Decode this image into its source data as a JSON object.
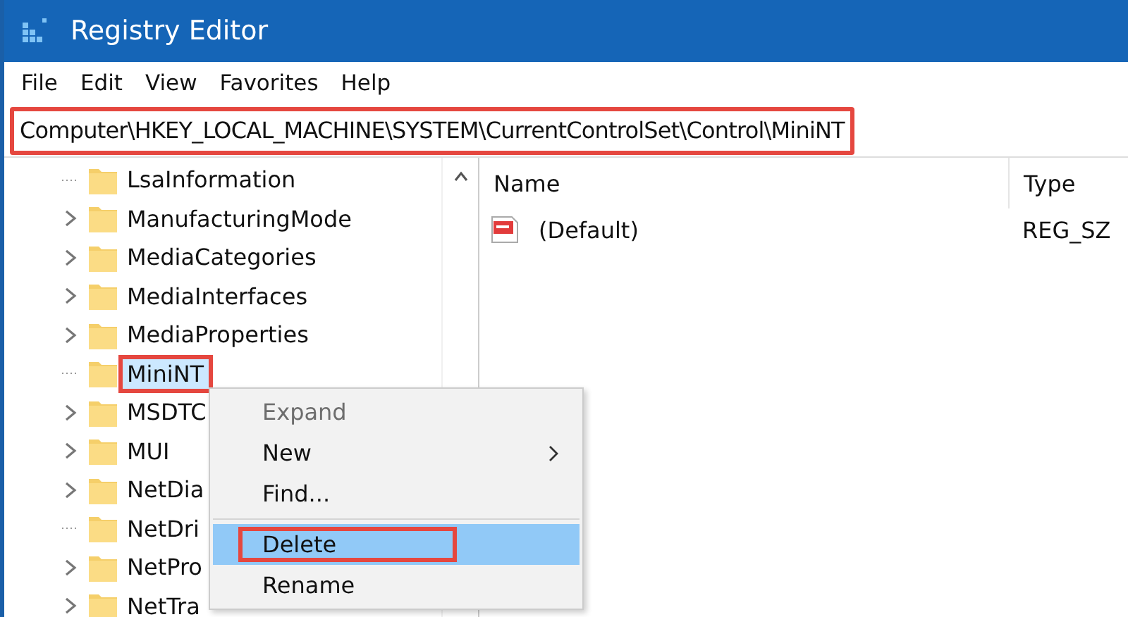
{
  "window": {
    "title": "Registry Editor"
  },
  "menu": [
    "File",
    "Edit",
    "View",
    "Favorites",
    "Help"
  ],
  "address": {
    "value": "Computer\\HKEY_LOCAL_MACHINE\\SYSTEM\\CurrentControlSet\\Control\\MiniNT",
    "annotated": true
  },
  "tree": [
    {
      "label": "LsaInformation",
      "has_children": false,
      "selected": false,
      "annotated": false
    },
    {
      "label": "ManufacturingMode",
      "has_children": true,
      "selected": false,
      "annotated": false
    },
    {
      "label": "MediaCategories",
      "has_children": true,
      "selected": false,
      "annotated": false
    },
    {
      "label": "MediaInterfaces",
      "has_children": true,
      "selected": false,
      "annotated": false
    },
    {
      "label": "MediaProperties",
      "has_children": true,
      "selected": false,
      "annotated": false
    },
    {
      "label": "MiniNT",
      "has_children": false,
      "selected": true,
      "annotated": true
    },
    {
      "label": "MSDTC",
      "has_children": true,
      "selected": false,
      "annotated": false
    },
    {
      "label": "MUI",
      "has_children": true,
      "selected": false,
      "annotated": false
    },
    {
      "label": "NetDia",
      "has_children": true,
      "selected": false,
      "annotated": false
    },
    {
      "label": "NetDri",
      "has_children": false,
      "selected": false,
      "annotated": false
    },
    {
      "label": "NetPro",
      "has_children": true,
      "selected": false,
      "annotated": false
    },
    {
      "label": "NetTra",
      "has_children": true,
      "selected": false,
      "annotated": false
    }
  ],
  "values_table": {
    "columns": [
      "Name",
      "Type"
    ],
    "rows": [
      {
        "name": "(Default)",
        "type": "REG_SZ"
      }
    ]
  },
  "context_menu": [
    {
      "kind": "item",
      "label": "Expand",
      "disabled": true,
      "submenu": false,
      "selected": false,
      "annotated": false
    },
    {
      "kind": "item",
      "label": "New",
      "disabled": false,
      "submenu": true,
      "selected": false,
      "annotated": false
    },
    {
      "kind": "item",
      "label": "Find...",
      "disabled": false,
      "submenu": false,
      "selected": false,
      "annotated": false
    },
    {
      "kind": "separator"
    },
    {
      "kind": "item",
      "label": "Delete",
      "disabled": false,
      "submenu": false,
      "selected": true,
      "annotated": true
    },
    {
      "kind": "item",
      "label": "Rename",
      "disabled": false,
      "submenu": false,
      "selected": false,
      "annotated": false
    }
  ]
}
